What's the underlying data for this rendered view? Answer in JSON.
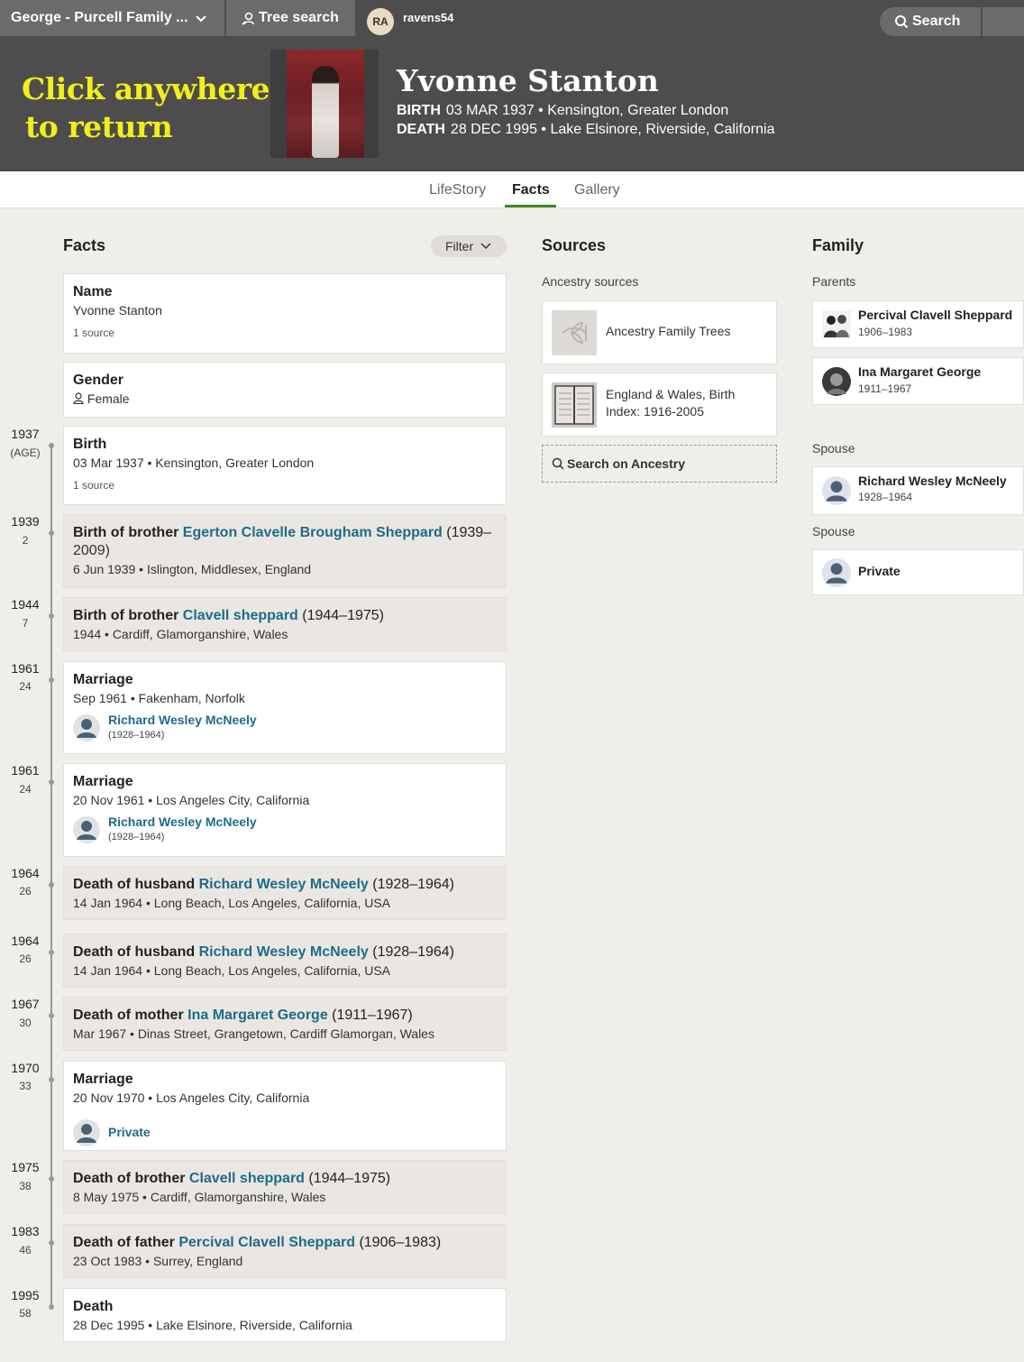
{
  "topbar": {
    "tree_name": "George - Purcell Family ...",
    "tree_search": "Tree search",
    "avatar_initials": "RA",
    "username": "ravens54",
    "search": "Search"
  },
  "header": {
    "overlay_line1": "Click anywhere",
    "overlay_line2": "to return",
    "name": "Yvonne Stanton",
    "birth_label": "BIRTH",
    "birth_value": "03 MAR 1937 • Kensington, Greater London",
    "death_label": "DEATH",
    "death_value": "28 DEC 1995 • Lake Elsinore, Riverside, California"
  },
  "tabs": [
    "LifeStory",
    "Facts",
    "Gallery"
  ],
  "facts": {
    "heading": "Facts",
    "filter": "Filter",
    "name_card": {
      "title": "Name",
      "value": "Yvonne Stanton",
      "source": "1 source"
    },
    "gender_card": {
      "title": "Gender",
      "value": "Female"
    },
    "timeline": [
      {
        "year": "1937",
        "age": "(AGE)"
      },
      {
        "year": "1939",
        "age": "2"
      },
      {
        "year": "1944",
        "age": "7"
      },
      {
        "year": "1961",
        "age": "24"
      },
      {
        "year": "1961",
        "age": "24"
      },
      {
        "year": "1964",
        "age": "26"
      },
      {
        "year": "1964",
        "age": "26"
      },
      {
        "year": "1967",
        "age": "30"
      },
      {
        "year": "1970",
        "age": "33"
      },
      {
        "year": "1975",
        "age": "38"
      },
      {
        "year": "1983",
        "age": "46"
      },
      {
        "year": "1995",
        "age": "58"
      }
    ],
    "events": [
      {
        "title": "Birth",
        "detail": "03 Mar 1937 • Kensington, Greater London",
        "source": "1 source"
      },
      {
        "prefix": "Birth of brother ",
        "link": "Egerton Clavelle Brougham Sheppard",
        "years": " (1939–",
        "years2": "2009)",
        "detail": "6 Jun 1939 • Islington, Middlesex, England"
      },
      {
        "prefix": "Birth of brother ",
        "link": "Clavell sheppard",
        "years": " (1944–1975)",
        "detail": "1944 • Cardiff, Glamorganshire, Wales"
      },
      {
        "title": "Marriage",
        "detail": "Sep 1961 • Fakenham, Norfolk",
        "spouse": "Richard Wesley McNeely",
        "spouse_years": "(1928–1964)"
      },
      {
        "title": "Marriage",
        "detail": "20 Nov 1961 • Los Angeles City, California",
        "spouse": "Richard Wesley McNeely",
        "spouse_years": "(1928–1964)"
      },
      {
        "prefix": "Death of husband ",
        "link": "Richard Wesley McNeely",
        "years": " (1928–1964)",
        "detail": "14 Jan 1964 • Long Beach, Los Angeles, California, USA"
      },
      {
        "prefix": "Death of husband ",
        "link": "Richard Wesley McNeely",
        "years": " (1928–1964)",
        "detail": "14 Jan 1964 • Long Beach, Los Angeles, California, USA"
      },
      {
        "prefix": "Death of mother ",
        "link": "Ina Margaret George",
        "years": " (1911–1967)",
        "detail": "Mar 1967 • Dinas Street, Grangetown, Cardiff Glamorgan, Wales"
      },
      {
        "title": "Marriage",
        "detail": "20 Nov 1970 • Los Angeles City, California",
        "spouse": "Private"
      },
      {
        "prefix": "Death of brother ",
        "link": "Clavell sheppard",
        "years": " (1944–1975)",
        "detail": "8 May 1975 • Cardiff, Glamorganshire, Wales"
      },
      {
        "prefix": "Death of father ",
        "link": "Percival Clavell Sheppard",
        "years": " (1906–1983)",
        "detail": "23 Oct 1983 • Surrey, England"
      },
      {
        "title": "Death",
        "detail": "28 Dec 1995 • Lake Elsinore, Riverside, California"
      }
    ]
  },
  "sources": {
    "heading": "Sources",
    "subheading": "Ancestry sources",
    "items": [
      {
        "label": "Ancestry Family Trees"
      },
      {
        "label1": "England & Wales, Birth",
        "label2": "Index: 1916-2005"
      }
    ],
    "search_label": "Search on Ancestry"
  },
  "family": {
    "heading": "Family",
    "parents_label": "Parents",
    "parents": [
      {
        "name": "Percival Clavell Sheppard",
        "years": "1906–1983"
      },
      {
        "name": "Ina Margaret George",
        "years": "1911–1967"
      }
    ],
    "spouse_label_1": "Spouse",
    "spouse_1": {
      "name": "Richard Wesley McNeely",
      "years": "1928–1964"
    },
    "spouse_label_2": "Spouse",
    "spouse_2": {
      "name": "Private"
    }
  },
  "colors": {
    "link": "#1d6c8b",
    "header_bg": "#4d4d4d",
    "overlay_text": "#f2ee1a",
    "tab_accent": "#3e8a1e"
  }
}
